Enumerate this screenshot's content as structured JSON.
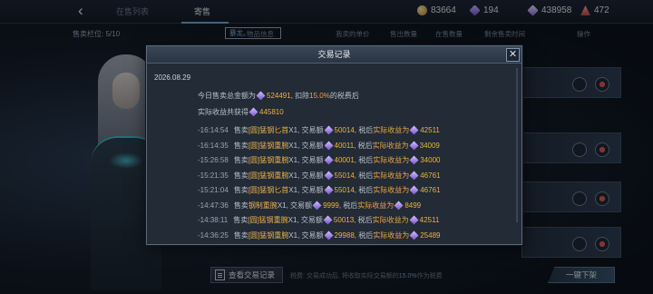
{
  "header": {
    "back_label": "‹",
    "tab_selling": "在售列表",
    "tab_consign": "寄售"
  },
  "resources": {
    "coin": "83664",
    "gem": "194",
    "crystal": "438958",
    "token": "472"
  },
  "slots_label": "售卖栏位: 5/10",
  "columns": {
    "search_value": "暴龙。",
    "item_info": "物品信息",
    "my_price": "我卖的单价",
    "sell_qty": "售出数量",
    "on_sale_qty": "在售数量",
    "remaining_time": "剩余售卖时间",
    "action": "操作"
  },
  "modal": {
    "title": "交易记录",
    "close_label": "✕",
    "date": "2026.08.29",
    "summary_prefix": "今日售卖总金额为",
    "summary_amount": "524491",
    "summary_tax_pre": ", 扣除",
    "summary_tax_rate": "15.0%",
    "summary_tax_post": "的税费后",
    "income_label": "实际收益共获得",
    "income_amount": "445810",
    "records": [
      {
        "time": "-16:14:54",
        "prefix": "售卖",
        "item": "[圆]猛钢匕首",
        "qty": "X1",
        "amount": "50014",
        "net": "42511"
      },
      {
        "time": "-16:14:35",
        "prefix": "售卖",
        "item": "[圆]猛钢重腕",
        "qty": "X1",
        "amount": "40011",
        "net": "34009"
      },
      {
        "time": "-15:26:58",
        "prefix": "售卖",
        "item": "[圆]猛钢重腕",
        "qty": "X1",
        "amount": "40001",
        "net": "34000"
      },
      {
        "time": "-15:21:35",
        "prefix": "售卖",
        "item": "[圆]猛钢重腕",
        "qty": "X1",
        "amount": "55014",
        "net": "46761"
      },
      {
        "time": "-15:21:04",
        "prefix": "售卖",
        "item": "[圆]猛钢匕首",
        "qty": "X1",
        "amount": "55014",
        "net": "46761"
      },
      {
        "time": "-14:47:36",
        "prefix": "售卖",
        "item": "钢制重腕",
        "qty": "X1",
        "amount": "9999",
        "net": "8499"
      },
      {
        "time": "-14:38:11",
        "prefix": "售卖",
        "item": "[圆]猛钢重腕",
        "qty": "X1",
        "amount": "50013",
        "net": "42511"
      },
      {
        "time": "-14:36:25",
        "prefix": "售卖",
        "item": "[圆]猛钢重腕",
        "qty": "X1",
        "amount": "29988",
        "net": "25489"
      }
    ],
    "record_amount_label": ", 交易额",
    "record_net_label_pre": ", 税后",
    "record_net_label": "实际收益为"
  },
  "bottom": {
    "log_button": "查看交易记录",
    "tax_note_pre": "税费: 交易成功后, 将收取实际交易额的",
    "tax_note_rate": "15.0%",
    "tax_note_post": "作为税费",
    "onekey_button": "一键下架"
  },
  "colors": {
    "accent_gold": "#ebb243",
    "gem_purple": "#7650cf",
    "panel": "#222b36"
  }
}
